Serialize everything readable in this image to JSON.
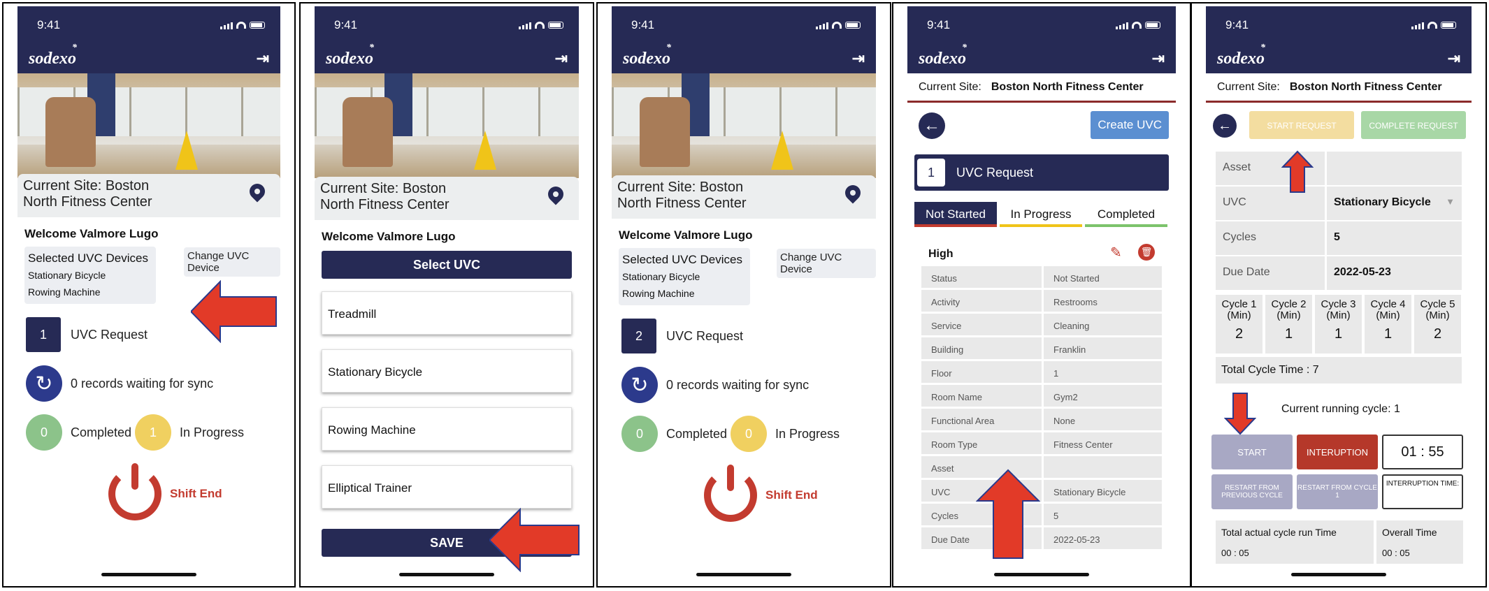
{
  "status": {
    "time": "9:41"
  },
  "brand": {
    "logo": "sodexo"
  },
  "p1": {
    "site": "Current Site: Boston North Fitness Center",
    "welcome": "Welcome Valmore Lugo",
    "selected_title": "Selected UVC Devices",
    "devices": [
      "Stationary Bicycle",
      "Rowing Machine"
    ],
    "change": "Change UVC Device",
    "req_count": "1",
    "req_label": "UVC Request",
    "sync": "0 records waiting for sync",
    "completed_count": "0",
    "completed_label": "Completed",
    "inprogress_count": "1",
    "inprogress_label": "In Progress",
    "shift": "Shift End"
  },
  "p2": {
    "site": "Current Site: Boston North Fitness Center",
    "welcome": "Welcome Valmore Lugo",
    "select": "Select UVC",
    "options": [
      "Treadmill",
      "Stationary Bicycle",
      "Rowing Machine",
      "Elliptical Trainer"
    ],
    "save": "SAVE"
  },
  "p3": {
    "site": "Current Site: Boston North Fitness Center",
    "welcome": "Welcome Valmore Lugo",
    "selected_title": "Selected UVC Devices",
    "devices": [
      "Stationary Bicycle",
      "Rowing Machine"
    ],
    "change": "Change UVC Device",
    "req_count": "2",
    "req_label": "UVC Request",
    "sync": "0 records waiting for sync",
    "completed_count": "0",
    "completed_label": "Completed",
    "inprogress_count": "0",
    "inprogress_label": "In Progress",
    "shift": "Shift End"
  },
  "p4": {
    "site_label": "Current Site:",
    "site_name": "Boston North Fitness Center",
    "create": "Create UVC",
    "req_count": "1",
    "req_label": "UVC Request",
    "tabs": [
      "Not Started",
      "In Progress",
      "Completed"
    ],
    "priority": "High",
    "rows": [
      {
        "k": "Status",
        "v": "Not Started"
      },
      {
        "k": "Activity",
        "v": "Restrooms"
      },
      {
        "k": "Service",
        "v": "Cleaning"
      },
      {
        "k": "Building",
        "v": "Franklin"
      },
      {
        "k": "Floor",
        "v": "1"
      },
      {
        "k": "Room Name",
        "v": "Gym2"
      },
      {
        "k": "Functional Area",
        "v": "None"
      },
      {
        "k": "Room Type",
        "v": "Fitness Center"
      },
      {
        "k": "Asset",
        "v": ""
      },
      {
        "k": "UVC",
        "v": "Stationary Bicycle"
      },
      {
        "k": "Cycles",
        "v": "5"
      },
      {
        "k": "Due Date",
        "v": "2022-05-23"
      }
    ],
    "colors": {
      "not_started": "#c33b2f",
      "in_progress": "#f0c419",
      "completed": "#7cc36b"
    }
  },
  "p5": {
    "site_label": "Current Site:",
    "site_name": "Boston North Fitness Center",
    "start_request": "START REQUEST",
    "complete_request": "COMPLETE REQUEST",
    "fields": [
      {
        "k": "Asset",
        "v": ""
      },
      {
        "k": "UVC",
        "v": "Stationary Bicycle"
      },
      {
        "k": "Cycles",
        "v": "5"
      },
      {
        "k": "Due Date",
        "v": "2022-05-23"
      }
    ],
    "cycles": [
      {
        "label": "Cycle 1 (Min)",
        "v": "2"
      },
      {
        "label": "Cycle 2 (Min)",
        "v": "1"
      },
      {
        "label": "Cycle 3 (Min)",
        "v": "1"
      },
      {
        "label": "Cycle 4 (Min)",
        "v": "1"
      },
      {
        "label": "Cycle 5 (Min)",
        "v": "2"
      }
    ],
    "total": "Total Cycle Time :  7",
    "current": "Current running cycle: 1",
    "start": "START",
    "interruption": "INTERUPTION",
    "timer": "01 : 55",
    "restart_prev": "RESTART FROM PREVIOUS CYCLE",
    "restart_c1": "RESTART FROM CYCLE 1",
    "interruption_time": "INTERRUPTION TIME:",
    "actual_label": "Total actual cycle run Time",
    "actual": "00 : 05",
    "overall_label": "Overall Time",
    "overall": "00 : 05"
  }
}
